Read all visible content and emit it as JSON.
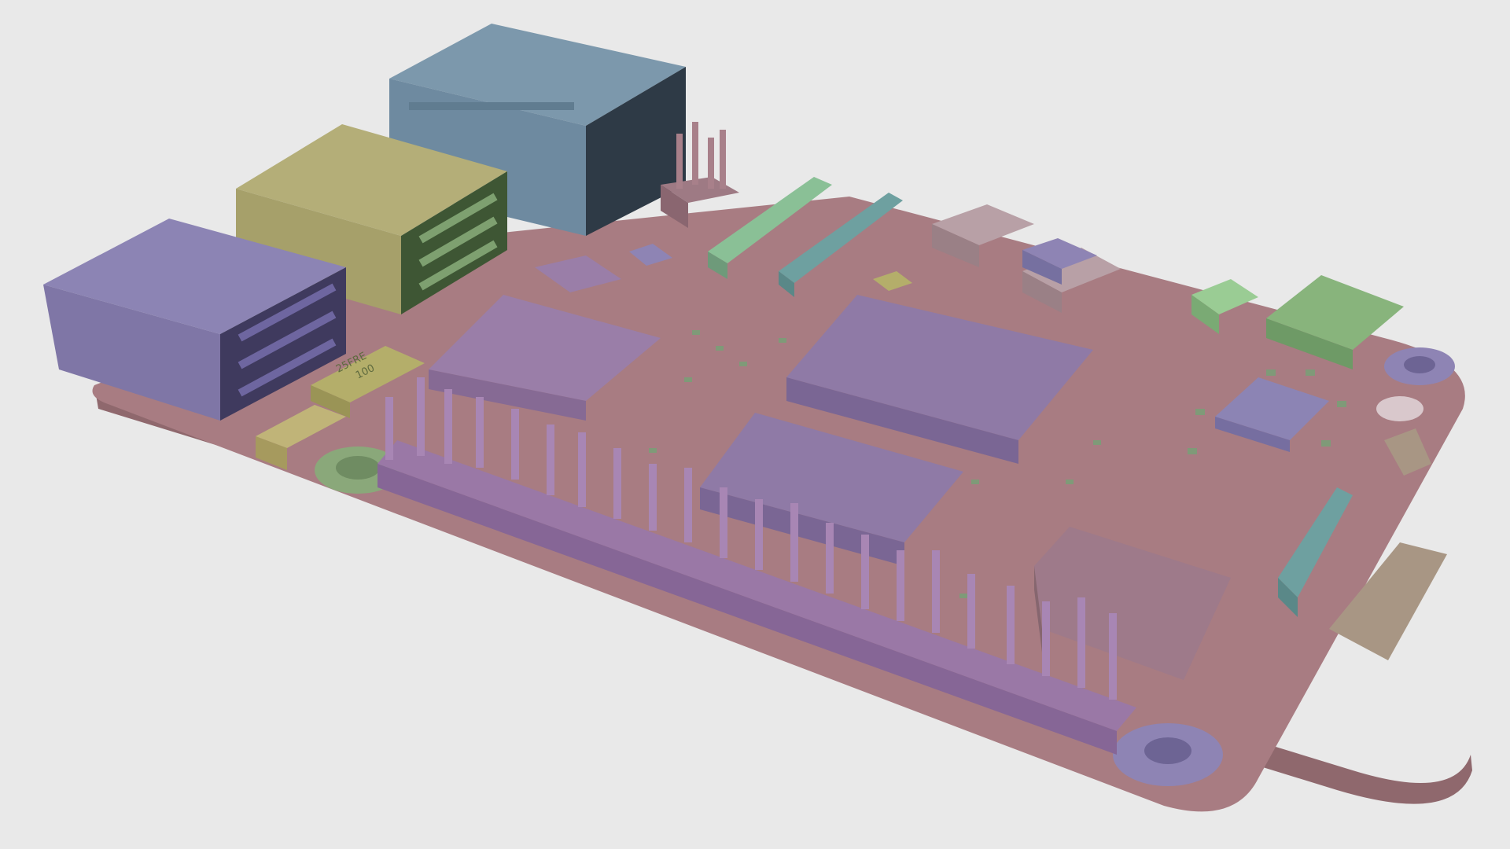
{
  "scene": {
    "background": "#e9e9e9",
    "subject": "single-board-computer-render",
    "colors": {
      "board": "#a87c82",
      "board_edge": "#8f686d",
      "usb_purple": "#7f76a6",
      "usb_olive": "#a6a06a",
      "ethernet": "#6e8aa0",
      "connector_teal": "#6ea0a0",
      "connector_green": "#76a07a",
      "chip_purple": "#8f7aa6",
      "header_pins": "#9a78a6"
    }
  },
  "labels": {
    "component_marking_line1": "100",
    "component_marking_line2": "25FRE"
  }
}
